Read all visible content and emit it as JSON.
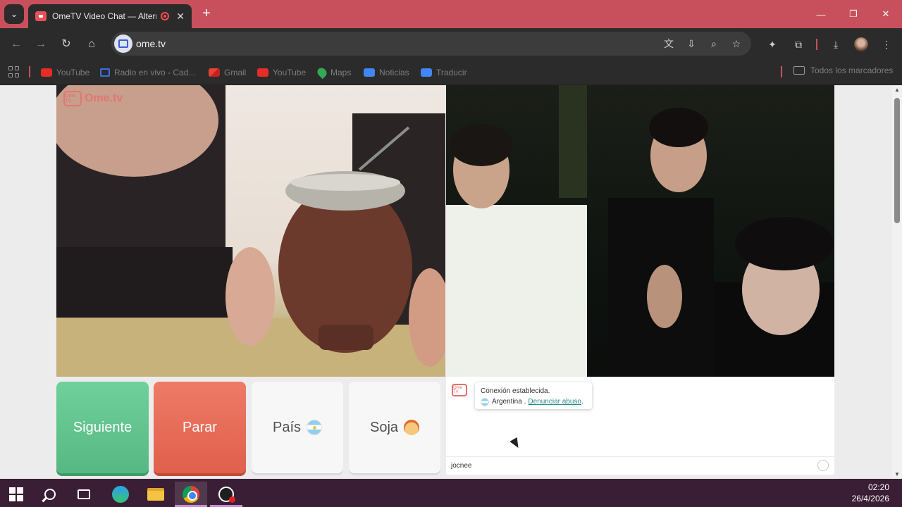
{
  "browser": {
    "tab_title": "OmeTV Video Chat — Alternati",
    "url": "ome.tv",
    "bookmarks": [
      {
        "label": "YouTube",
        "icon": "youtube-icon"
      },
      {
        "label": "Radio en vivo - Cad...",
        "icon": "c5n-icon"
      },
      {
        "label": "Gmail",
        "icon": "gmail-icon"
      },
      {
        "label": "YouTube",
        "icon": "youtube-icon"
      },
      {
        "label": "Maps",
        "icon": "maps-icon"
      },
      {
        "label": "Noticias",
        "icon": "news-icon"
      },
      {
        "label": "Traducir",
        "icon": "translate-icon"
      }
    ],
    "all_bookmarks": "Todos los marcadores"
  },
  "page": {
    "logo_text": "Ome.tv",
    "logo_box": "Ome TV",
    "buttons": {
      "next": "Siguiente",
      "stop": "Parar",
      "country": "País",
      "gender": "Soja"
    },
    "chat": {
      "status": "Conexión establecida.",
      "country": "Argentina .",
      "report": "Denunciar abuso",
      "report_suffix": ".",
      "input_value": "jocnee"
    }
  },
  "taskbar": {
    "time": "02:20",
    "date": "26/4/2026"
  },
  "colors": {
    "tab_strip": "#c8505c",
    "next_button": "#5fbf8b",
    "stop_button": "#e6675a",
    "taskbar": "#3a1e35"
  }
}
